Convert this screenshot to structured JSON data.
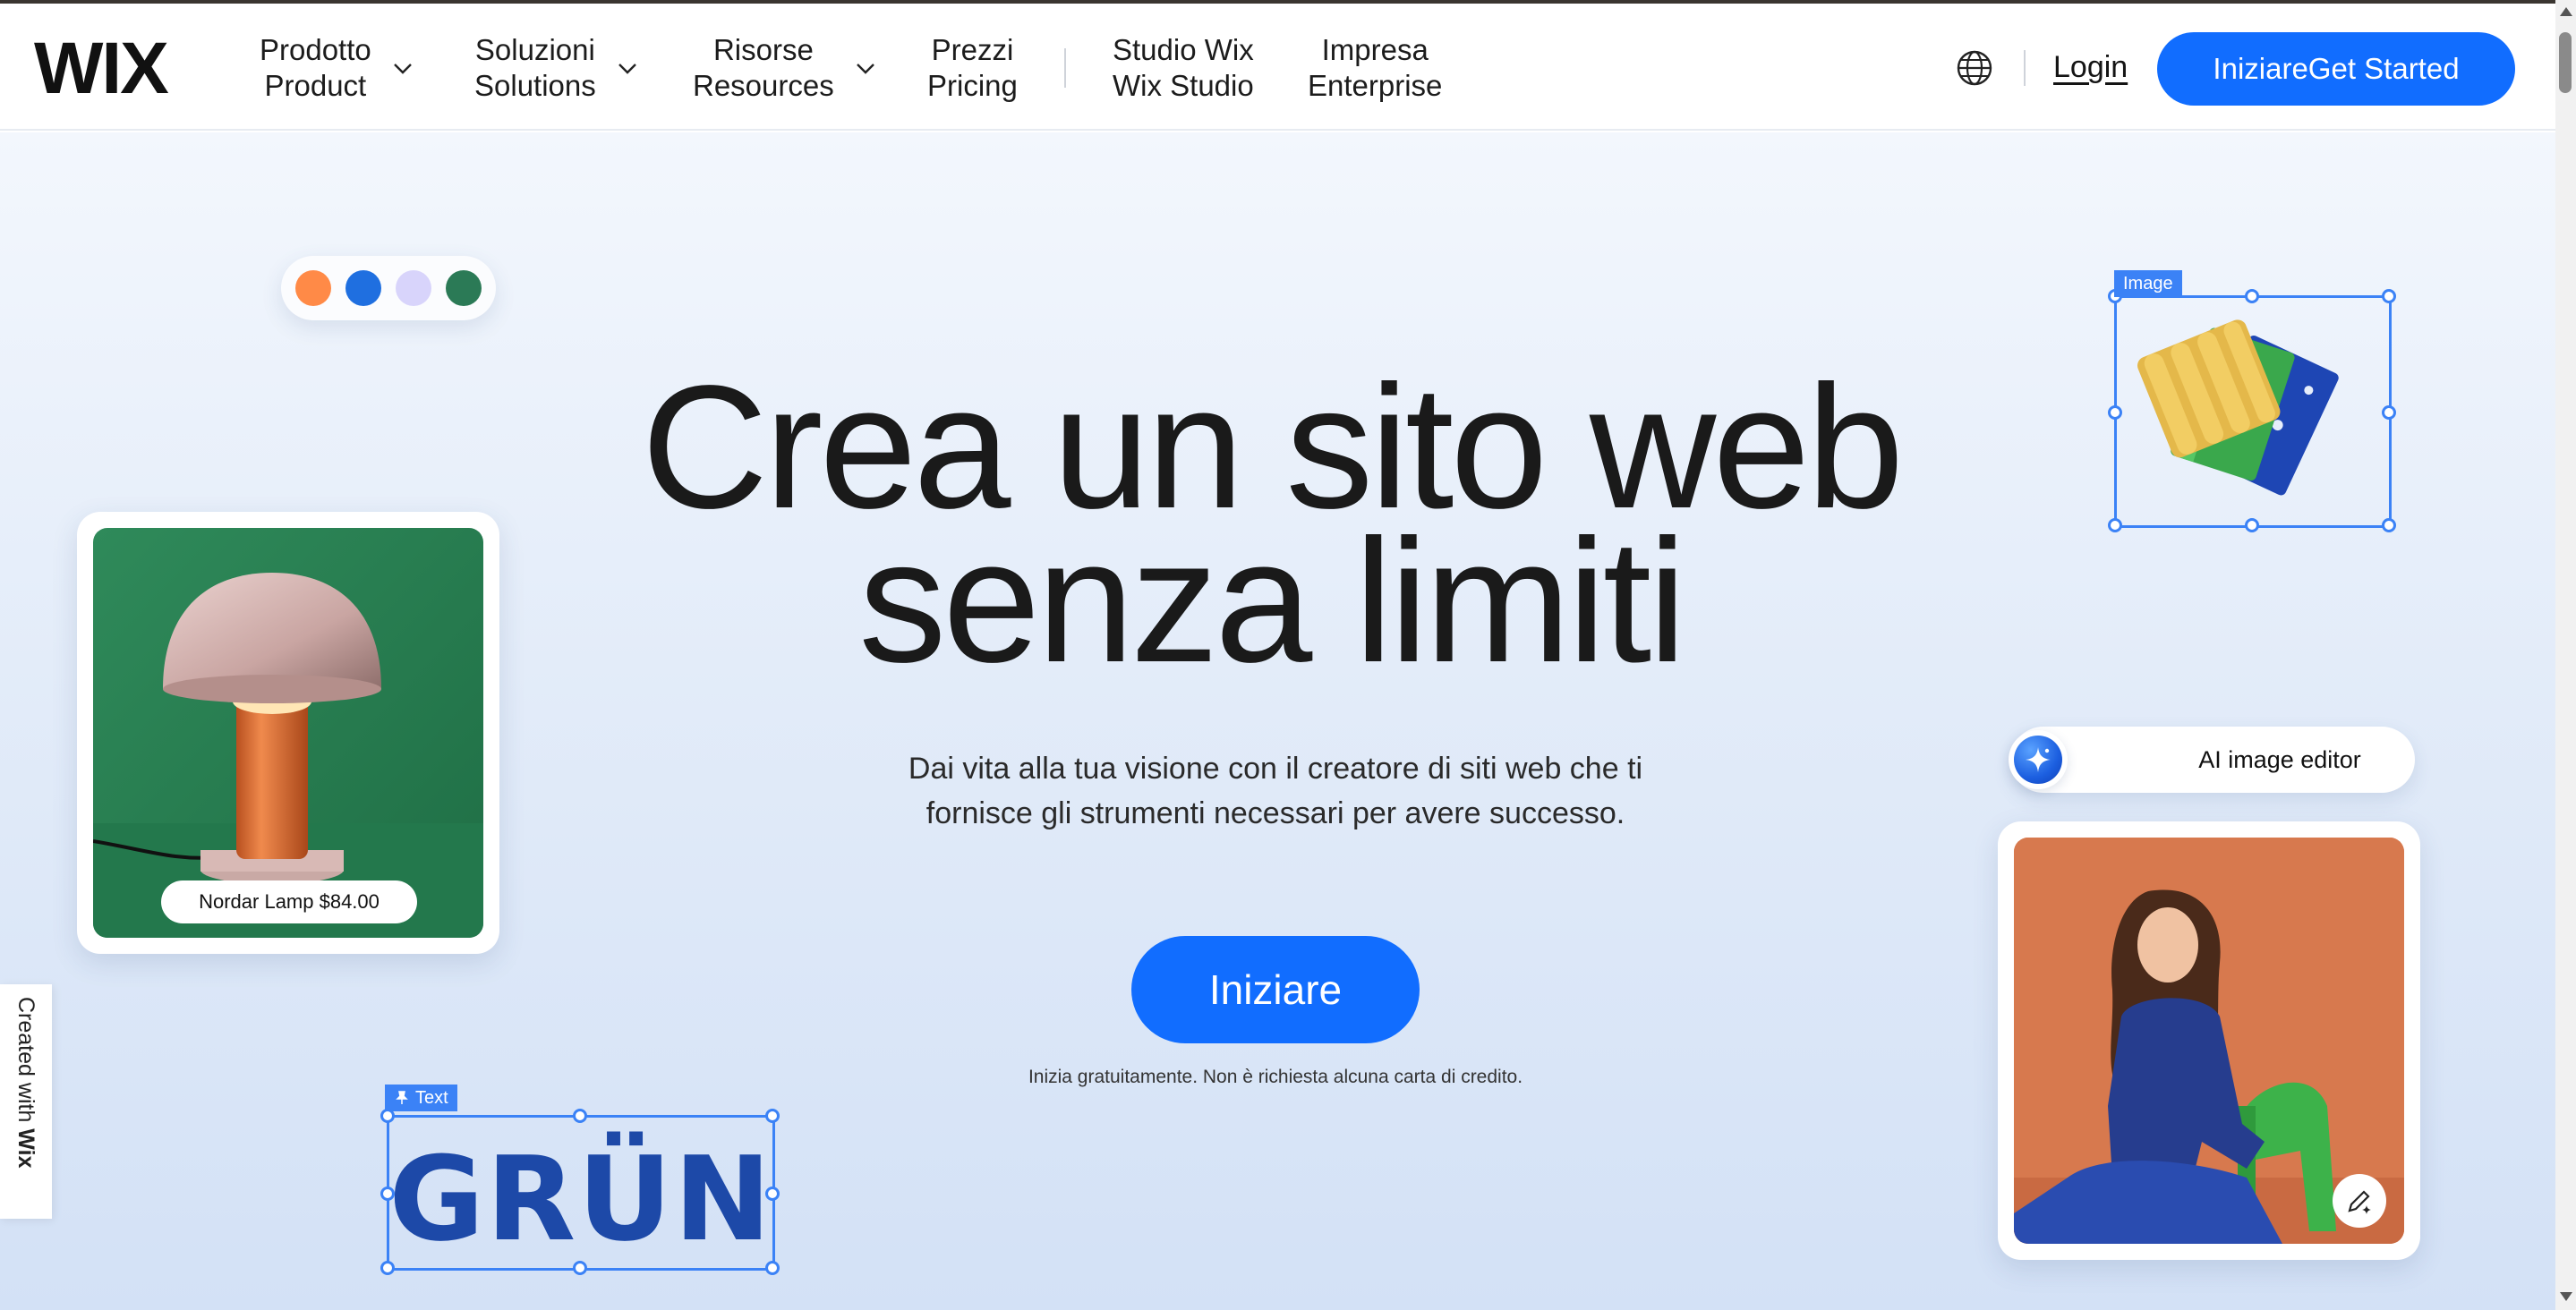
{
  "nav": {
    "logo_text": "WIX",
    "items": [
      {
        "line1": "Prodotto",
        "line2": "Product"
      },
      {
        "line1": "Soluzioni",
        "line2": "Solutions"
      },
      {
        "line1": "Risorse",
        "line2": "Resources"
      },
      {
        "line1": "Prezzi",
        "line2": "Pricing"
      },
      {
        "line1": "Studio Wix",
        "line2": "Wix Studio"
      },
      {
        "line1": "Impresa",
        "line2": "Enterprise"
      }
    ],
    "login_label": "Login",
    "cta_label": "IniziareGet Started"
  },
  "hero": {
    "headline_line1": "Crea un sito web",
    "headline_line2": "senza limiti",
    "subtext": "Dai vita alla tua visione con il creatore di siti web che ti fornisce gli strumenti necessari per avere successo.",
    "cta_label": "Iniziare",
    "disclaimer": "Inizia gratuitamente. Non è richiesta alcuna carta di credito."
  },
  "color_dots": [
    "#ff8a47",
    "#1f6fe0",
    "#d8d4fb",
    "#2b7a56"
  ],
  "lamp_card": {
    "tag": "Nordar Lamp $84.00"
  },
  "image_widget": {
    "label": "Image"
  },
  "text_widget": {
    "label": "Text",
    "logo_text": "GRÜN"
  },
  "ai_editor": {
    "label": "AI image editor"
  },
  "created_with": {
    "prefix": "Created with ",
    "brand": "Wix"
  },
  "colors": {
    "accent": "#116dff",
    "selection": "#3b82f6"
  }
}
